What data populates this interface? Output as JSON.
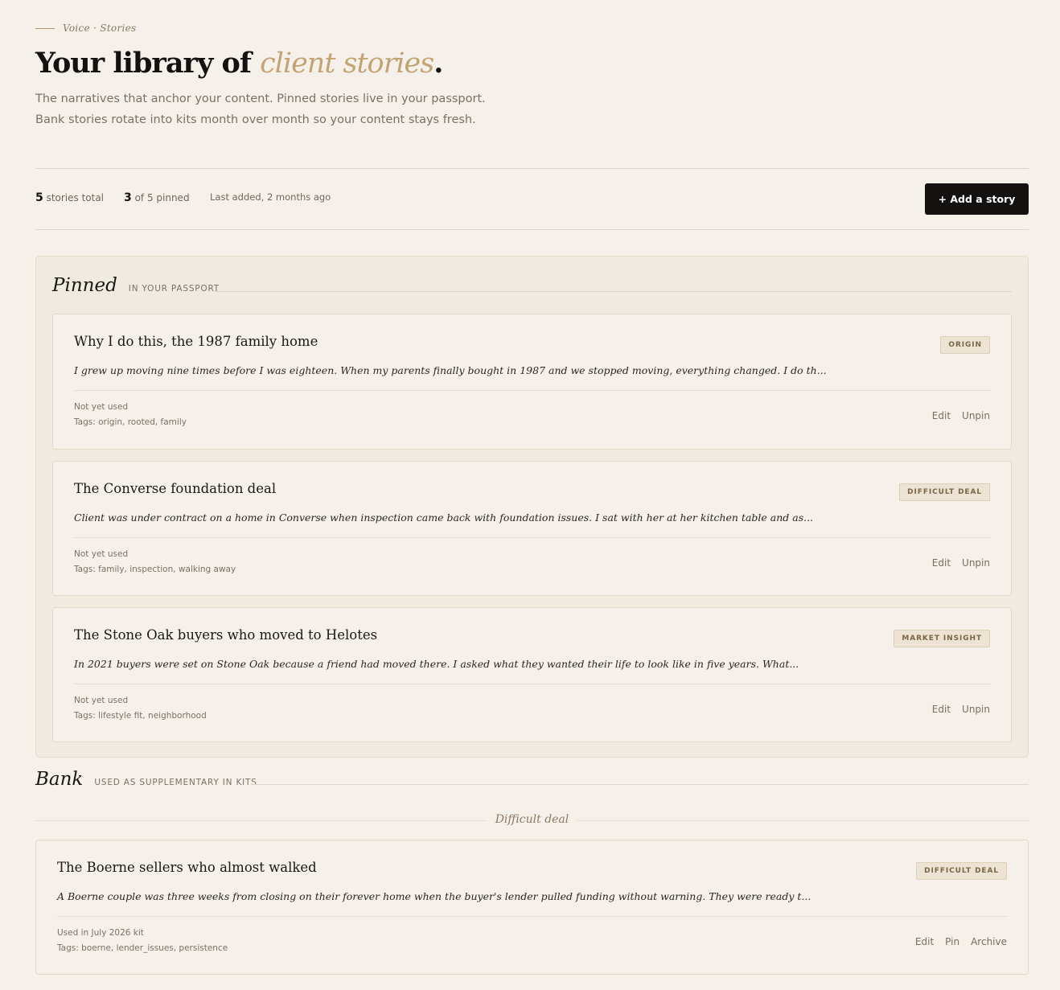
{
  "header": {
    "eyebrow": "Voice · Stories",
    "title_main": "Your library of ",
    "title_accent": "client stories",
    "title_end": ".",
    "subtitle": "The narratives that anchor your content. Pinned stories live in your passport. Bank stories rotate into kits month over month so your content stays fresh."
  },
  "stats": {
    "total_count": "5",
    "total_label": " stories total",
    "pinned_count": "3",
    "pinned_label": " of 5 pinned",
    "last_added": "Last added, 2 months ago",
    "add_button": "+ Add a story"
  },
  "pinned_section": {
    "name": "Pinned",
    "note": "In your passport",
    "cards": [
      {
        "title": "Why I do this, the 1987 family home",
        "badge": "ORIGIN",
        "excerpt": "I grew up moving nine times before I was eighteen. When my parents finally bought in 1987 and we stopped moving, everything changed. I do th...",
        "usage": "Not yet used",
        "tags": "Tags: origin, rooted, family",
        "actions": [
          "Edit",
          "Unpin"
        ]
      },
      {
        "title": "The Converse foundation deal",
        "badge": "DIFFICULT DEAL",
        "excerpt": "Client was under contract on a home in Converse when inspection came back with foundation issues. I sat with her at her kitchen table and as...",
        "usage": "Not yet used",
        "tags": "Tags: family, inspection, walking away",
        "actions": [
          "Edit",
          "Unpin"
        ]
      },
      {
        "title": "The Stone Oak buyers who moved to Helotes",
        "badge": "MARKET INSIGHT",
        "excerpt": "In 2021 buyers were set on Stone Oak because a friend had moved there. I asked what they wanted their life to look like in five years. What...",
        "usage": "Not yet used",
        "tags": "Tags: lifestyle fit, neighborhood",
        "actions": [
          "Edit",
          "Unpin"
        ]
      }
    ]
  },
  "bank_section": {
    "name": "Bank",
    "note": "Used as supplementary in kits",
    "group_label": "Difficult deal",
    "cards": [
      {
        "title": "The Boerne sellers who almost walked",
        "badge": "DIFFICULT DEAL",
        "excerpt": "A Boerne couple was three weeks from closing on their forever home when the buyer's lender pulled funding without warning. They were ready t...",
        "usage": "Used in July 2026 kit",
        "tags": "Tags: boerne, lender_issues, persistence",
        "actions": [
          "Edit",
          "Pin",
          "Archive"
        ]
      }
    ]
  },
  "colors": {
    "background": "#f5f1ea",
    "accent": "#c2a472",
    "button": "#141210"
  }
}
